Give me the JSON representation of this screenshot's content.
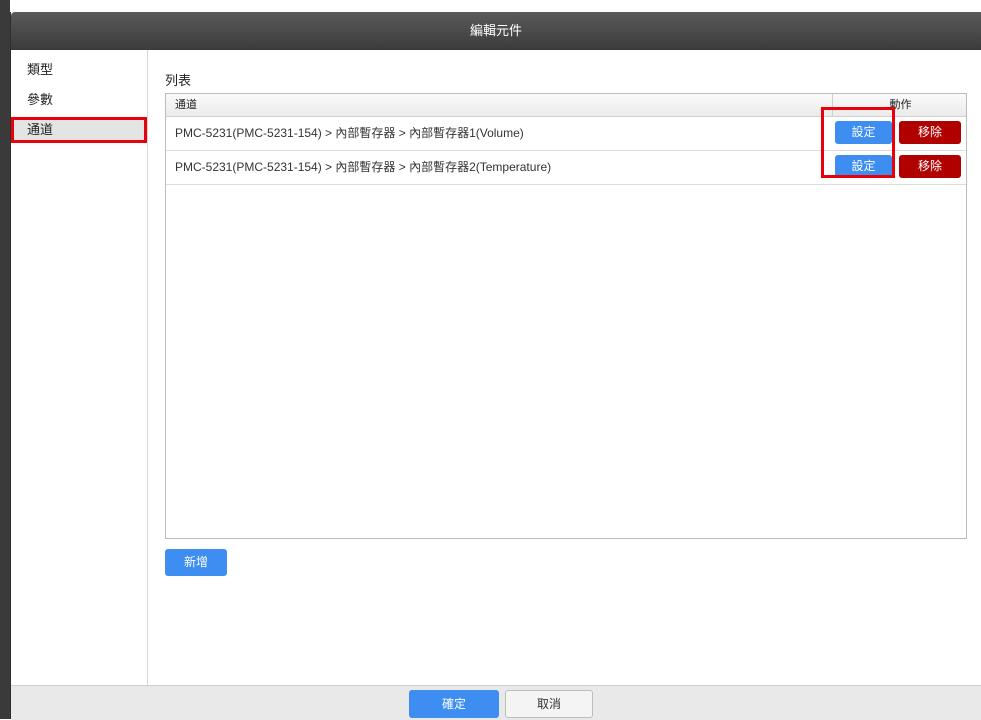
{
  "window": {
    "title": "編輯元件"
  },
  "sidebar": {
    "items": [
      {
        "label": "類型"
      },
      {
        "label": "參數"
      },
      {
        "label": "通道"
      }
    ],
    "active_index": 2
  },
  "main": {
    "section_title": "列表",
    "table": {
      "headers": {
        "channel": "通道",
        "action": "動作"
      },
      "rows": [
        {
          "channel": "PMC-5231(PMC-5231-154) > 內部暫存器 > 內部暫存器1(Volume)",
          "set_label": "設定",
          "remove_label": "移除"
        },
        {
          "channel": "PMC-5231(PMC-5231-154) > 內部暫存器 > 內部暫存器2(Temperature)",
          "set_label": "設定",
          "remove_label": "移除"
        }
      ]
    },
    "add_label": "新增"
  },
  "footer": {
    "ok_label": "確定",
    "cancel_label": "取消"
  },
  "colors": {
    "accent_blue": "#3d8ef0",
    "danger_red": "#b10000",
    "highlight_red": "#e8000b",
    "titlebar": "#3b3b3b"
  }
}
